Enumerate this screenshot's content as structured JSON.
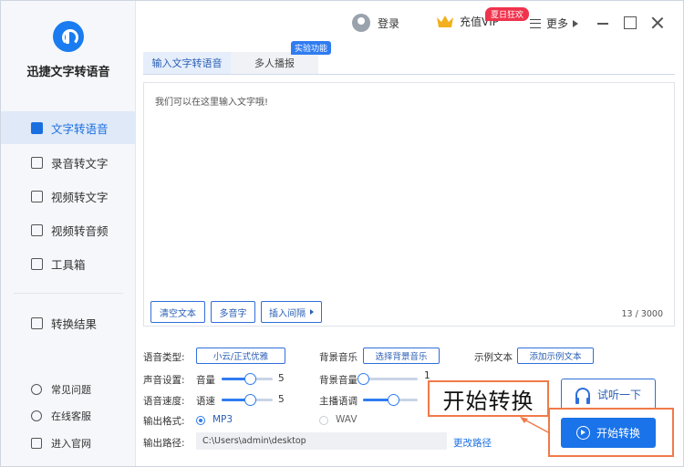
{
  "app": {
    "name": "迅捷文字转语音"
  },
  "header": {
    "login": "登录",
    "vip": "充值VIP",
    "vip_badge": "夏日狂欢",
    "more": "更多"
  },
  "sidebar": {
    "items": [
      {
        "label": "文字转语音",
        "active": true
      },
      {
        "label": "录音转文字"
      },
      {
        "label": "视频转文字"
      },
      {
        "label": "视频转音频"
      },
      {
        "label": "工具箱"
      }
    ],
    "result": "转换结果",
    "footer": [
      {
        "label": "常见问题"
      },
      {
        "label": "在线客服"
      },
      {
        "label": "进入官网"
      }
    ]
  },
  "tabs": [
    {
      "label": "输入文字转语音",
      "active": true
    },
    {
      "label": "多人播报"
    }
  ],
  "tab_badge": "实验功能",
  "editor": {
    "placeholder": "我们可以在这里输入文字哦!",
    "counter": "13 / 3000",
    "buttons": {
      "clear": "清空文本",
      "polyphone": "多音字",
      "pause": "插入间隔"
    }
  },
  "settings": {
    "voice_type_label": "语音类型:",
    "voice_type_value": "小云/正式优雅",
    "bg_music_label": "背景音乐",
    "bg_music_btn": "选择背景音乐",
    "example_label": "示例文本",
    "example_btn": "添加示例文本",
    "sound_label": "声音设置:",
    "volume_label": "音量",
    "volume_value": "5",
    "bg_volume_label": "背景音量",
    "bg_volume_value": "1",
    "speed_label": "语音速度:",
    "speed_sub": "语速",
    "speed_value": "5",
    "pitch_label": "主播语调",
    "format_label": "输出格式:",
    "format_mp3": "MP3",
    "format_wav": "WAV",
    "format_selected": "MP3",
    "path_label": "输出路径:",
    "path_value": "C:\\Users\\admin\\desktop",
    "change_path": "更改路径",
    "volume_level": 0.55,
    "bg_volume_level": 0.0,
    "speed_level": 0.55,
    "pitch_level": 0.55
  },
  "actions": {
    "listen": "试听一下",
    "convert": "开始转换"
  },
  "callout": {
    "text": "开始转换"
  },
  "colors": {
    "accent": "#1a73e8",
    "highlight": "#f07a48",
    "badge": "#f0334d"
  }
}
